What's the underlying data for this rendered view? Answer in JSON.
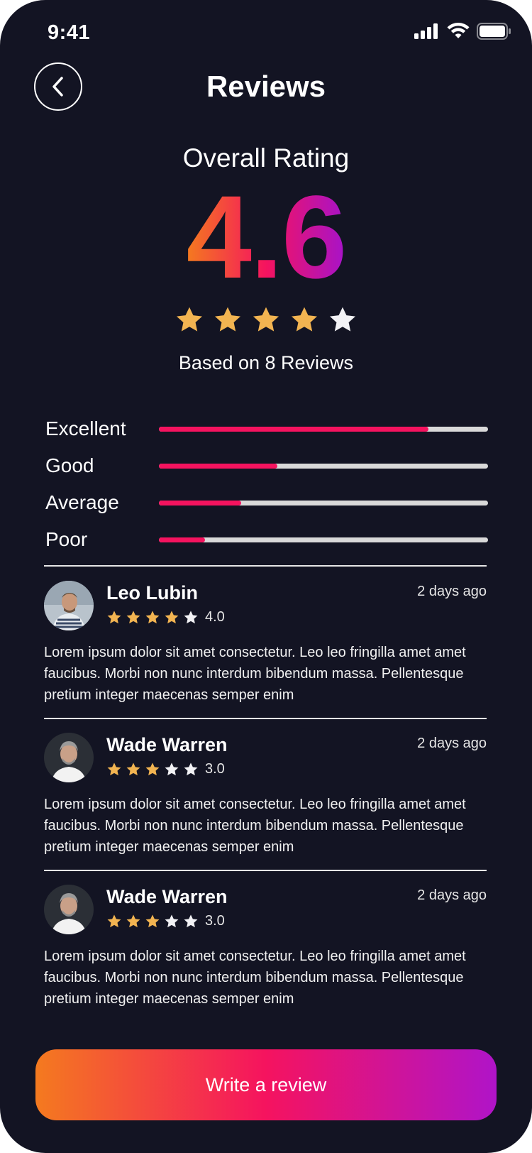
{
  "status_bar": {
    "time": "9:41"
  },
  "header": {
    "title": "Reviews"
  },
  "overall": {
    "label": "Overall Rating",
    "value": "4.6",
    "stars_filled": 4,
    "stars_total": 5,
    "based_on": "Based on 8 Reviews"
  },
  "breakdown": [
    {
      "label": "Excellent",
      "fraction": 0.82
    },
    {
      "label": "Good",
      "fraction": 0.36
    },
    {
      "label": "Average",
      "fraction": 0.25
    },
    {
      "label": "Poor",
      "fraction": 0.14
    }
  ],
  "reviews": [
    {
      "name": "Leo Lubin",
      "date": "2 days ago",
      "stars_filled": 4,
      "score": "4.0",
      "text": "Lorem ipsum dolor sit amet consectetur. Leo leo fringilla amet amet faucibus. Morbi non nunc interdum bibendum massa. Pellentesque pretium integer maecenas semper enim"
    },
    {
      "name": "Wade Warren",
      "date": "2 days ago",
      "stars_filled": 3,
      "score": "3.0",
      "text": "Lorem ipsum dolor sit amet consectetur. Leo leo fringilla amet amet faucibus. Morbi non nunc interdum bibendum massa. Pellentesque pretium integer maecenas semper enim"
    },
    {
      "name": "Wade Warren",
      "date": "2 days ago",
      "stars_filled": 3,
      "score": "3.0",
      "text": "Lorem ipsum dolor sit amet consectetur. Leo leo fringilla amet amet faucibus. Morbi non nunc interdum bibendum massa. Pellentesque pretium integer maecenas semper enim"
    }
  ],
  "cta": {
    "label": "Write a review"
  },
  "colors": {
    "background": "#131423",
    "star_filled": "#F2B451",
    "star_empty": "#F2F2F5",
    "bar_fill": "#F5135F",
    "bar_track": "#D9D9D9",
    "gradient_start": "#F47A1F",
    "gradient_mid": "#F5135F",
    "gradient_end": "#A713C9"
  },
  "icons": [
    "back-arrow-icon",
    "signal-icon",
    "wifi-icon",
    "battery-icon",
    "star-icon"
  ]
}
